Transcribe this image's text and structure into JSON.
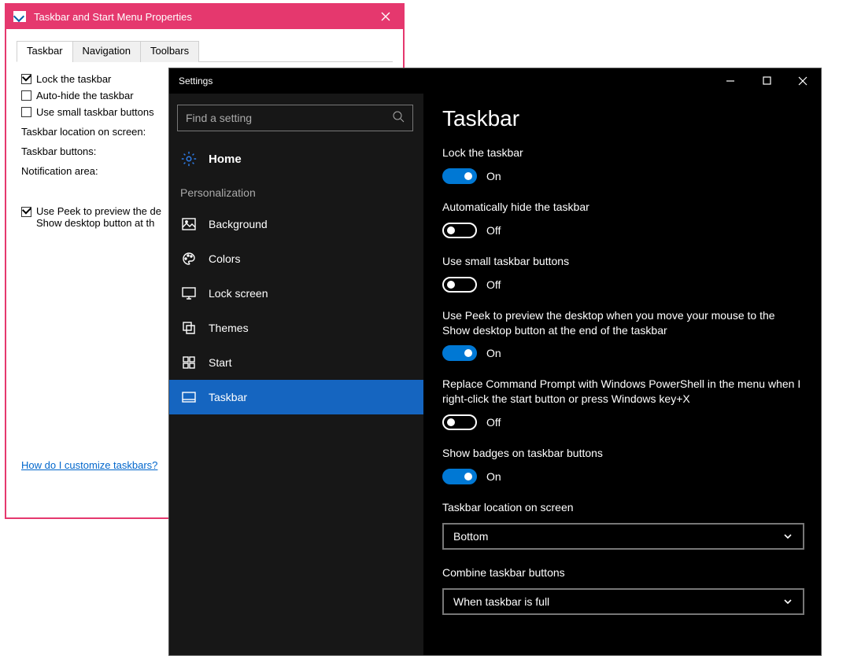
{
  "legacy": {
    "title": "Taskbar and Start Menu Properties",
    "tabs": [
      "Taskbar",
      "Navigation",
      "Toolbars"
    ],
    "active_tab": 0,
    "checks": [
      {
        "label": "Lock the taskbar",
        "checked": true
      },
      {
        "label": "Auto-hide the taskbar",
        "checked": false
      },
      {
        "label": "Use small taskbar buttons",
        "checked": false
      }
    ],
    "labels": {
      "location": "Taskbar location on screen:",
      "buttons": "Taskbar buttons:",
      "notif": "Notification area:"
    },
    "peek": {
      "checked": true,
      "line1": "Use Peek to preview the de",
      "line2": "Show desktop button at th"
    },
    "help": "How do I customize taskbars?"
  },
  "settings": {
    "title": "Settings",
    "search_placeholder": "Find a setting",
    "home": "Home",
    "section": "Personalization",
    "nav": [
      {
        "id": "background",
        "label": "Background"
      },
      {
        "id": "colors",
        "label": "Colors"
      },
      {
        "id": "lockscreen",
        "label": "Lock screen"
      },
      {
        "id": "themes",
        "label": "Themes"
      },
      {
        "id": "start",
        "label": "Start"
      },
      {
        "id": "taskbar",
        "label": "Taskbar"
      }
    ],
    "selected_nav": "taskbar",
    "page": {
      "title": "Taskbar",
      "items": [
        {
          "type": "toggle",
          "label": "Lock the taskbar",
          "on": true,
          "state_on": "On",
          "state_off": "Off"
        },
        {
          "type": "toggle",
          "label": "Automatically hide the taskbar",
          "on": false,
          "state_on": "On",
          "state_off": "Off"
        },
        {
          "type": "toggle",
          "label": "Use small taskbar buttons",
          "on": false,
          "state_on": "On",
          "state_off": "Off"
        },
        {
          "type": "toggle",
          "label": "Use Peek to preview the desktop when you move your mouse to the Show desktop button at the end of the taskbar",
          "on": true,
          "state_on": "On",
          "state_off": "Off"
        },
        {
          "type": "toggle",
          "label": "Replace Command Prompt with Windows PowerShell in the menu when I right-click the start button or press Windows key+X",
          "on": false,
          "state_on": "On",
          "state_off": "Off"
        },
        {
          "type": "toggle",
          "label": "Show badges on taskbar buttons",
          "on": true,
          "state_on": "On",
          "state_off": "Off"
        },
        {
          "type": "dropdown",
          "label": "Taskbar location on screen",
          "value": "Bottom"
        },
        {
          "type": "dropdown",
          "label": "Combine taskbar buttons",
          "value": "When taskbar is full"
        }
      ]
    }
  }
}
